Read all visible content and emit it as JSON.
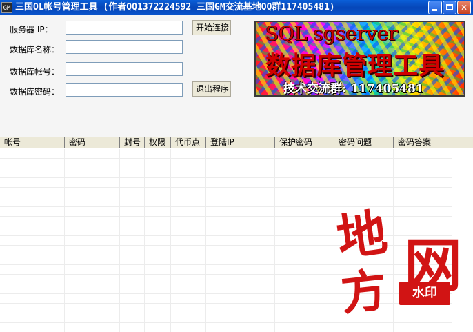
{
  "window": {
    "icon_text": "GM",
    "title": "三国OL帐号管理工具 (作者QQ1372224592 三国GM交流基地QQ群117405481)"
  },
  "form": {
    "server_label": "服务器  IP：",
    "server_value": "",
    "dbname_label": "数据库名称：",
    "dbname_value": "",
    "dbuser_label": "数据库帐号：",
    "dbuser_value": "",
    "dbpass_label": "数据库密码：",
    "dbpass_value": "",
    "connect_button": "开始连接",
    "exit_button": "退出程序"
  },
  "banner": {
    "line1": "SQL sgserver",
    "line2": "数据库管理工具",
    "line3": "技术交流群: 117405481"
  },
  "table": {
    "columns": [
      "帐号",
      "密码",
      "封号",
      "权限",
      "代币点",
      "登陆IP",
      "保护密码",
      "密码问题",
      "密码答案"
    ],
    "rows": []
  },
  "watermark": {
    "char_di": "地",
    "char_fang": "方",
    "char_wang": "网",
    "stamp": "水印"
  }
}
